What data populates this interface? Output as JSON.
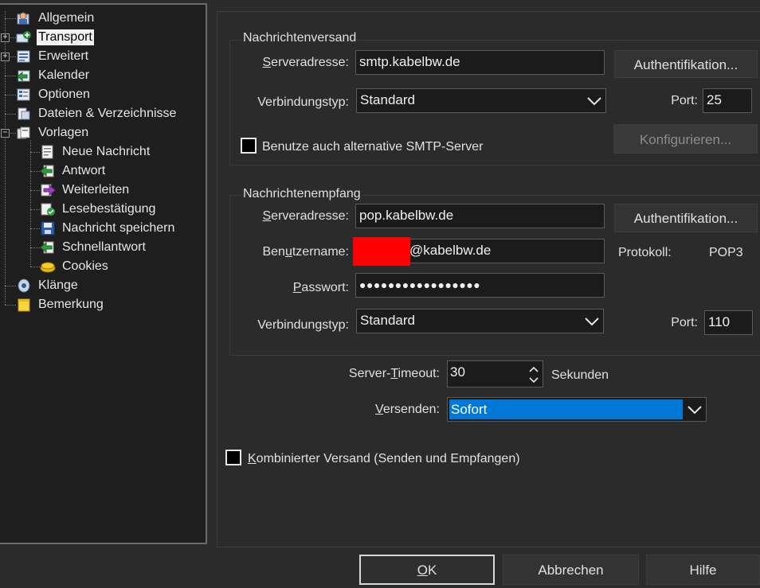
{
  "tree": {
    "items": [
      {
        "label": "Allgemein",
        "icon": "general-settings-icon",
        "expander": ""
      },
      {
        "label": "Transport",
        "icon": "transport-icon",
        "expander": "+"
      },
      {
        "label": "Erweitert",
        "icon": "advanced-icon",
        "expander": "+"
      },
      {
        "label": "Kalender",
        "icon": "calendar-icon",
        "expander": ""
      },
      {
        "label": "Optionen",
        "icon": "options-icon",
        "expander": ""
      },
      {
        "label": "Dateien & Verzeichnisse",
        "icon": "folders-icon",
        "expander": ""
      },
      {
        "label": "Vorlagen",
        "icon": "templates-icon",
        "expander": "−"
      },
      {
        "label": "Neue Nachricht",
        "icon": "new-message-icon",
        "expander": ""
      },
      {
        "label": "Antwort",
        "icon": "reply-icon",
        "expander": ""
      },
      {
        "label": "Weiterleiten",
        "icon": "forward-icon",
        "expander": ""
      },
      {
        "label": "Lesebestätigung",
        "icon": "read-receipt-icon",
        "expander": ""
      },
      {
        "label": "Nachricht speichern",
        "icon": "save-message-icon",
        "expander": ""
      },
      {
        "label": "Schnellantwort",
        "icon": "quick-reply-icon",
        "expander": ""
      },
      {
        "label": "Cookies",
        "icon": "cookies-icon",
        "expander": ""
      },
      {
        "label": "Klänge",
        "icon": "sounds-icon",
        "expander": ""
      },
      {
        "label": "Bemerkung",
        "icon": "note-icon",
        "expander": ""
      }
    ],
    "selected": "Transport"
  },
  "send": {
    "legend": "Nachrichtenversand",
    "server_label_u": "S",
    "server_label_rest": "erveradresse:",
    "server_value": "smtp.kabelbw.de",
    "auth_button": "Authentifikation...",
    "conn_label": "Verbindungstyp:",
    "conn_value": "Standard",
    "port_label": "Port:",
    "port_value": "25",
    "alt_smtp_label": "Benutze auch alternative SMTP-Server",
    "alt_smtp_checked": false,
    "configure_button": "Konfigurieren..."
  },
  "receive": {
    "legend": "Nachrichtenempfang",
    "server_label_u": "S",
    "server_label_rest": "erveradresse:",
    "server_value": "pop.kabelbw.de",
    "auth_button": "Authentifikation...",
    "user_label_pre": "Ben",
    "user_label_u": "u",
    "user_label_post": "tzername:",
    "user_value": "@kabelbw.de",
    "protocol_label": "Protokoll:",
    "protocol_value": "POP3",
    "pass_label_u": "P",
    "pass_label_rest": "asswort:",
    "pass_value": "●●●●●●●●●●●●●●●●●",
    "conn_label": "Verbindungstyp:",
    "conn_value": "Standard",
    "port_label": "Port:",
    "port_value": "110"
  },
  "timeout": {
    "label_pre": "Server-",
    "label_u": "T",
    "label_post": "imeout:",
    "value": "30",
    "unit": "Sekunden"
  },
  "send_mode": {
    "label_u": "V",
    "label_rest": "ersenden:",
    "value": "Sofort"
  },
  "combined": {
    "label_u": "K",
    "label_rest": "ombinierter Versand (Senden und Empfangen)",
    "checked": false
  },
  "buttons": {
    "ok_u": "O",
    "ok_rest": "K",
    "cancel": "Abbrechen",
    "help": "Hilfe"
  },
  "colors": {
    "accent_selection": "#0078d7",
    "redaction": "#ff0000"
  }
}
